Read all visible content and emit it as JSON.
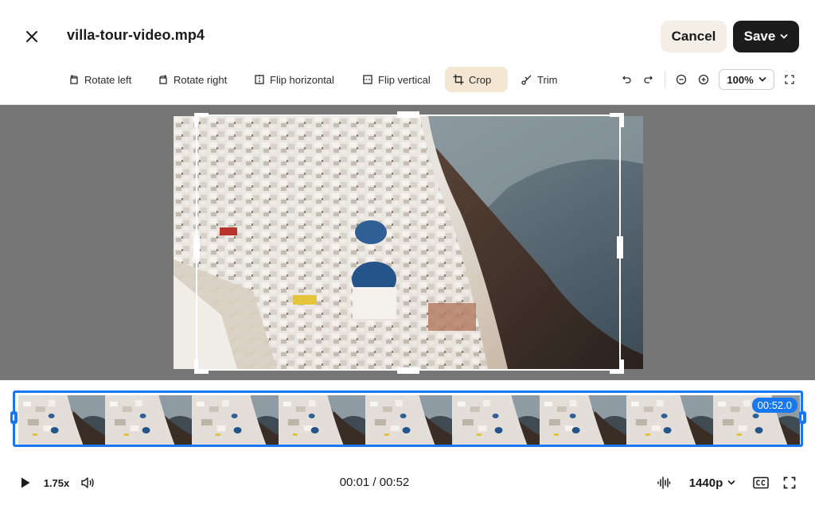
{
  "app": {
    "file_name": "villa-tour-video.mp4",
    "cancel_label": "Cancel",
    "save_label": "Save"
  },
  "toolbar": {
    "tools": [
      {
        "id": "rotate-left",
        "label": "Rotate left",
        "icon": "rotate-left-icon",
        "active": false
      },
      {
        "id": "rotate-right",
        "label": "Rotate right",
        "icon": "rotate-right-icon",
        "active": false
      },
      {
        "id": "flip-horizontal",
        "label": "Flip horizontal",
        "icon": "flip-horizontal-icon",
        "active": false
      },
      {
        "id": "flip-vertical",
        "label": "Flip vertical",
        "icon": "flip-vertical-icon",
        "active": false
      },
      {
        "id": "crop",
        "label": "Crop",
        "icon": "crop-icon",
        "active": true
      },
      {
        "id": "trim",
        "label": "Trim",
        "icon": "trim-icon",
        "active": false
      }
    ],
    "controls": [
      "undo-icon",
      "redo-icon",
      "zoom-out-icon",
      "zoom-in-icon",
      "fit-screen-icon"
    ],
    "zoom_level": "100%"
  },
  "timeline": {
    "duration_badge": "00:52.0",
    "frame_count": 9
  },
  "player": {
    "speed": "1.75x",
    "timecode": "00:01 / 00:52",
    "quality": "1440p",
    "icons": [
      "play-icon",
      "volume-icon",
      "audio-waveform-icon",
      "captions-icon",
      "fullscreen-icon"
    ]
  },
  "colors": {
    "accent": "#1877f2",
    "save_bg": "#1c1c1c",
    "cancel_bg": "#f3efe6",
    "active_tool_bg": "#f3e6d2",
    "stage_bg": "#767676"
  }
}
